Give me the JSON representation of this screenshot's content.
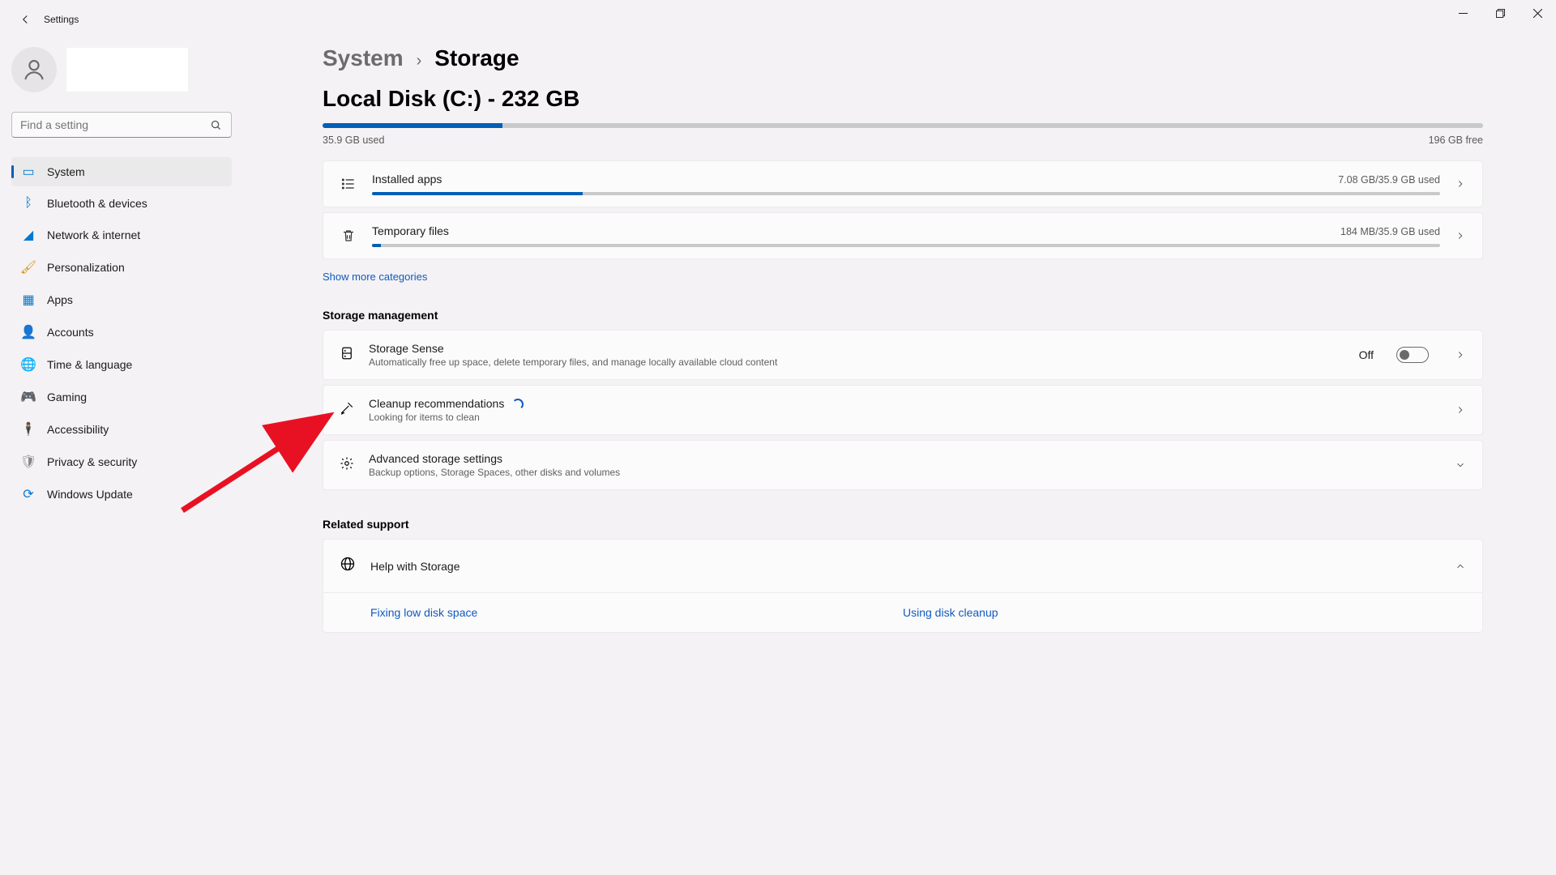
{
  "app": {
    "title": "Settings"
  },
  "search": {
    "placeholder": "Find a setting"
  },
  "nav": {
    "items": [
      {
        "label": "System"
      },
      {
        "label": "Bluetooth & devices"
      },
      {
        "label": "Network & internet"
      },
      {
        "label": "Personalization"
      },
      {
        "label": "Apps"
      },
      {
        "label": "Accounts"
      },
      {
        "label": "Time & language"
      },
      {
        "label": "Gaming"
      },
      {
        "label": "Accessibility"
      },
      {
        "label": "Privacy & security"
      },
      {
        "label": "Windows Update"
      }
    ]
  },
  "breadcrumb": {
    "parent": "System",
    "current": "Storage"
  },
  "disk": {
    "title": "Local Disk (C:) - 232 GB",
    "used_label": "35.9 GB used",
    "free_label": "196 GB free",
    "used_percent": 15.5
  },
  "categories": [
    {
      "name": "Installed apps",
      "used": "7.08 GB/35.9 GB used",
      "percent": 19.7
    },
    {
      "name": "Temporary files",
      "used": "184 MB/35.9 GB used",
      "percent": 0.5
    }
  ],
  "show_more": "Show more categories",
  "mgmt": {
    "heading": "Storage management",
    "sense": {
      "title": "Storage Sense",
      "sub": "Automatically free up space, delete temporary files, and manage locally available cloud content",
      "state": "Off"
    },
    "cleanup": {
      "title": "Cleanup recommendations",
      "sub": "Looking for items to clean"
    },
    "advanced": {
      "title": "Advanced storage settings",
      "sub": "Backup options, Storage Spaces, other disks and volumes"
    }
  },
  "related": {
    "heading": "Related support",
    "help_title": "Help with Storage",
    "links": [
      "Fixing low disk space",
      "Using disk cleanup"
    ]
  }
}
